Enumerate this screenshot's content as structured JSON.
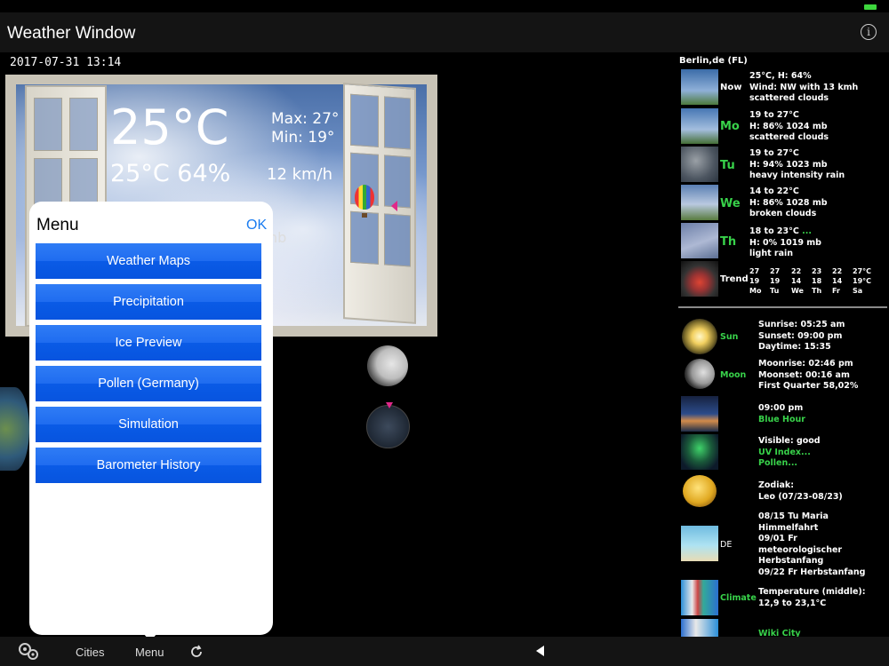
{
  "app": {
    "title": "Weather Window",
    "datetime": "2017-07-31 13:14"
  },
  "window": {
    "temperature": "25°C",
    "temp_humidity": "25°C 64%",
    "max": "Max: 27°",
    "min": "Min: 19°",
    "wind": "12 km/h",
    "pressure_fragment": "nb"
  },
  "menu": {
    "title": "Menu",
    "ok_label": "OK",
    "items": [
      "Weather Maps",
      "Precipitation",
      "Ice Preview",
      "Pollen (Germany)",
      "Simulation",
      "Barometer History"
    ]
  },
  "forecast": {
    "city": "Berlin,de (FL)",
    "days": [
      {
        "label": "Now",
        "line1": "25°C, H: 64%",
        "line2": "Wind: NW with 13 kmh",
        "line3": "scattered clouds"
      },
      {
        "label": "Mo",
        "line1": "19 to 27°C",
        "line2": "H: 86% 1024 mb",
        "line3": "scattered clouds"
      },
      {
        "label": "Tu",
        "line1": "19 to 27°C",
        "line2": "H: 94% 1023 mb",
        "line3": "heavy intensity rain"
      },
      {
        "label": "We",
        "line1": "14 to 22°C",
        "line2": "H: 86% 1028 mb",
        "line3": "broken clouds"
      },
      {
        "label": "Th",
        "line1": "18 to 23°C",
        "line1_suffix": " ...",
        "line2": "H: 0% 1019 mb",
        "line3": "light rain"
      }
    ],
    "trend": {
      "label": "Trend",
      "highs": [
        "27",
        "27",
        "22",
        "23",
        "22",
        "27°C"
      ],
      "lows": [
        "19",
        "19",
        "14",
        "18",
        "14",
        "19°C"
      ],
      "days": [
        "Mo",
        "Tu",
        "We",
        "Th",
        "Fr",
        "Sa"
      ]
    }
  },
  "astro": {
    "sun": {
      "label": "Sun",
      "sunrise": "Sunrise: 05:25 am",
      "sunset": "Sunset: 09:00 pm",
      "daytime": "Daytime: 15:35"
    },
    "moon": {
      "label": "Moon",
      "moonrise": "Moonrise: 02:46 pm",
      "moonset": "Moonset: 00:16 am",
      "phase": "First Quarter 58,02%"
    },
    "bluehour": {
      "time": "09:00 pm",
      "label": "Blue Hour"
    },
    "aurora": {
      "visible": "Visible: good",
      "uv": "UV Index...",
      "pollen": "Pollen..."
    },
    "zodiac": {
      "title": "Zodiak:",
      "value": "Leo (07/23-08/23)"
    },
    "holidays": {
      "label": "DE",
      "lines": [
        "08/15 Tu Maria",
        "Himmelfahrt",
        "09/01 Fr",
        "meteorologischer",
        "Herbstanfang",
        "09/22 Fr Herbstanfang"
      ]
    },
    "climate": {
      "label": "Climate",
      "line1": "Temperature (middle):",
      "line2": "12,9 to 23,1°C"
    },
    "wiki": {
      "label": "Wiki City"
    }
  },
  "toolbar": {
    "cities": "Cities",
    "menu": "Menu"
  },
  "colors": {
    "accent_green": "#38d24a",
    "button_blue": "#1f6cf0",
    "ok_blue": "#1a7cf0"
  }
}
